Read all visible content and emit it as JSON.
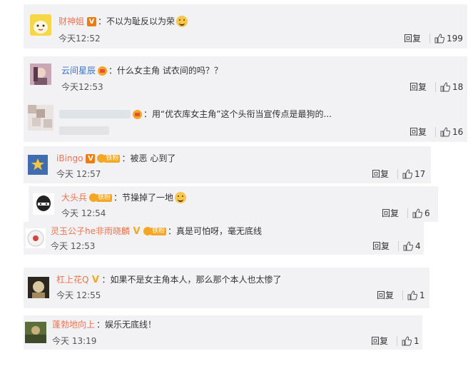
{
  "reply_label": "回复",
  "comments": [
    {
      "user": "财神姐",
      "text": "不以为耻反以为荣",
      "time": "今天12:52",
      "likes": "199"
    },
    {
      "user": "云间星辰",
      "text": "什么女主角 试衣间的吗？？",
      "time": "今天12:53",
      "likes": "18"
    },
    {
      "user": "",
      "text": "用“优衣库女主角”这个头衔当宣传点是最狗的...",
      "time": "",
      "likes": "16"
    },
    {
      "user": "iBingo",
      "text": "被恶 心到了",
      "time": "今天 12:57",
      "likes": "17"
    },
    {
      "user": "大头兵",
      "text": "节操掉了一地",
      "time": "今天 12:54",
      "likes": "6"
    },
    {
      "user": "灵玉公子he非雨晓麟",
      "text": "真是可怕呀，毫无底线",
      "time": "今天 12:53",
      "likes": "4"
    },
    {
      "user": "杠上花Q",
      "text": "如果不是女主角本人，那么那个本人也太惨了",
      "time": "今天 12:55",
      "likes": "1"
    },
    {
      "user": "蓬勃地向上",
      "text": "娱乐无底线！",
      "time": "今天 13:19",
      "likes": "1"
    }
  ],
  "fan_badge_label": "铁粉",
  "verified_badge": "V",
  "colors": {
    "username": "#eb7350",
    "card_bg": "#f2f2f5",
    "badge": "#f5a623"
  },
  "icons": {
    "like": "thumbs-up-icon",
    "emoji": "smile-emoji-icon"
  }
}
